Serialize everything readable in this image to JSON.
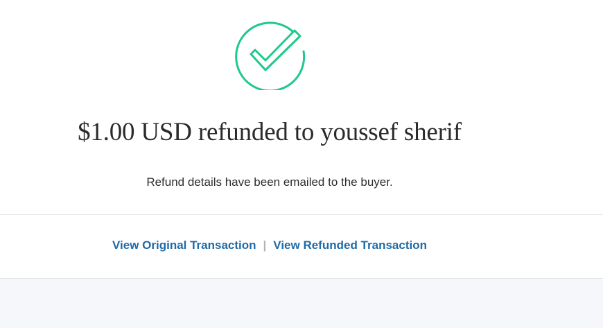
{
  "status_icon": "check-circle-icon",
  "colors": {
    "success": "#1ec98b",
    "link": "#1f6aa8",
    "text": "#2b2b2b",
    "separator": "#b0b3b6",
    "footer_bg": "#f5f7fa"
  },
  "confirmation": {
    "headline": "$1.00 USD refunded to youssef sherif",
    "subtext": "Refund details have been emailed to the buyer."
  },
  "links": {
    "view_original": "View Original Transaction",
    "separator": "|",
    "view_refunded": "View Refunded Transaction"
  }
}
